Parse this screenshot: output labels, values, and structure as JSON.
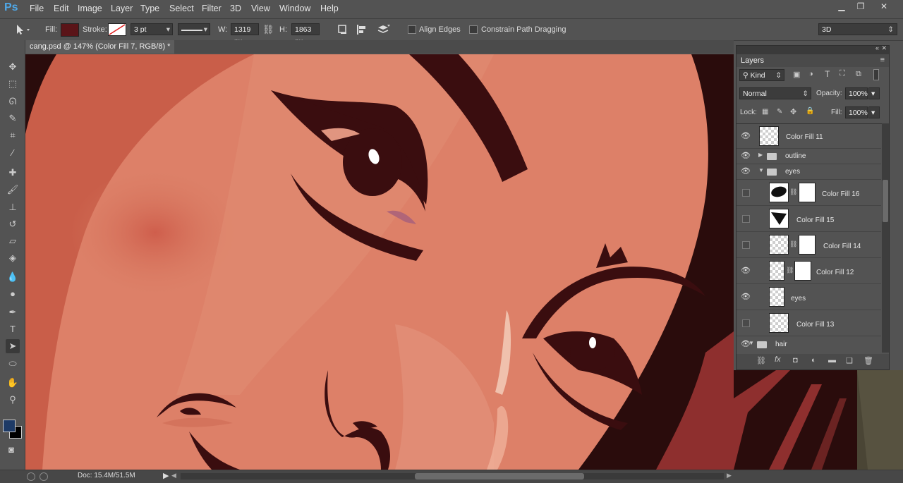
{
  "app": {
    "logo": "Ps",
    "brand_color": "#4fa8e8"
  },
  "menu": [
    "File",
    "Edit",
    "Image",
    "Layer",
    "Type",
    "Select",
    "Filter",
    "3D",
    "View",
    "Window",
    "Help"
  ],
  "options": {
    "fill_label": "Fill:",
    "fill_color": "#5a1418",
    "stroke_label": "Stroke:",
    "stroke_width": "3 pt",
    "w_label": "W:",
    "w_value": "1319 px",
    "h_label": "H:",
    "h_value": "1863 px",
    "align_edges": "Align Edges",
    "constrain": "Constrain Path Dragging",
    "workspace": "3D"
  },
  "document": {
    "tab_title": "cang.psd @ 147% (Color Fill 7, RGB/8) *"
  },
  "status": {
    "doc_size": "Doc: 15.4M/51.5M"
  },
  "colors": {
    "foreground": "#1d3a66",
    "background": "#000000"
  },
  "layers_panel": {
    "title": "Layers",
    "filter": "Kind",
    "blend_mode": "Normal",
    "opacity_label": "Opacity:",
    "opacity": "100%",
    "lock_label": "Lock:",
    "fill_label": "Fill:",
    "fill": "100%",
    "layers": [
      {
        "name": "Color Fill 11",
        "visible": true
      },
      {
        "name": "outline",
        "visible": true,
        "group": true
      },
      {
        "name": "eyes",
        "visible": true,
        "group": true
      },
      {
        "name": "Color Fill 16",
        "visible": false
      },
      {
        "name": "Color Fill 15",
        "visible": false
      },
      {
        "name": "Color Fill 14",
        "visible": false
      },
      {
        "name": "Color Fill 12",
        "visible": true
      },
      {
        "name": "eyes",
        "visible": true
      },
      {
        "name": "Color Fill 13",
        "visible": false
      },
      {
        "name": "hair",
        "visible": true,
        "group": true
      }
    ]
  }
}
